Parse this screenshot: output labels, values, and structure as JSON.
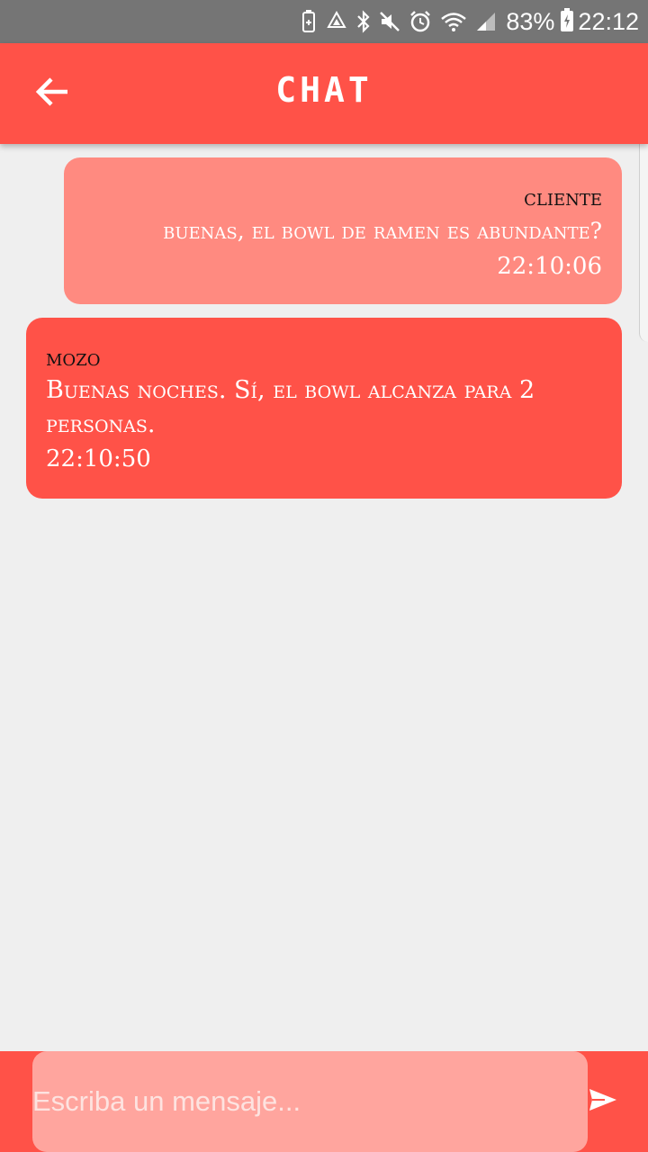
{
  "status_bar": {
    "battery_percent": "83%",
    "time": "22:12",
    "icons": [
      "battery-saver-icon",
      "recycle-icon",
      "bluetooth-icon",
      "mute-icon",
      "alarm-icon",
      "wifi-icon",
      "signal-icon",
      "battery-charging-icon"
    ]
  },
  "app_bar": {
    "title": "CHAT",
    "back_icon": "arrow-left-icon"
  },
  "messages": [
    {
      "sender": "cliente",
      "text": "buenas, el bowl de ramen es abundante?",
      "time": "22:10:06",
      "align": "right",
      "color": "#ff8a80"
    },
    {
      "sender": "mozo",
      "text": "Buenas noches. Sí, el bowl alcanza para 2 personas.",
      "time": "22:10:50",
      "align": "left",
      "color": "#ff5248"
    }
  ],
  "composer": {
    "placeholder": "Escriba un mensaje...",
    "value": "",
    "send_icon": "send-icon"
  },
  "colors": {
    "accent": "#ff5248",
    "sent_bubble": "#ff8a80",
    "input_background": "#ffa59e",
    "background": "#efefef",
    "status_bar": "#757575"
  }
}
